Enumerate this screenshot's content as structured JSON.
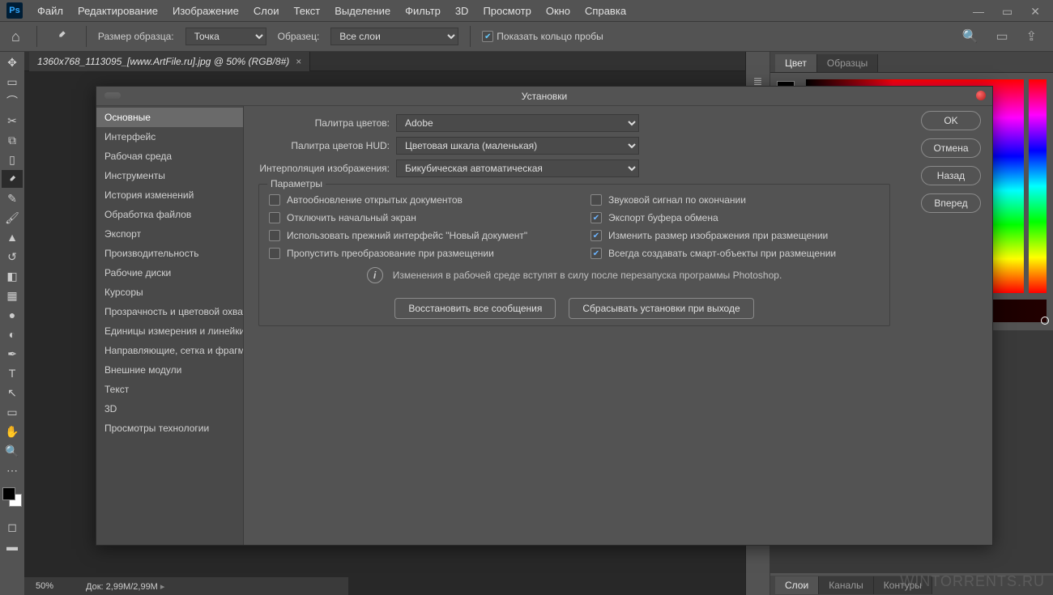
{
  "menubar": {
    "items": [
      "Файл",
      "Редактирование",
      "Изображение",
      "Слои",
      "Текст",
      "Выделение",
      "Фильтр",
      "3D",
      "Просмотр",
      "Окно",
      "Справка"
    ]
  },
  "optionsbar": {
    "sample_label": "Размер образца:",
    "sample_value": "Точка",
    "source_label": "Образец:",
    "source_value": "Все слои",
    "ring_label": "Показать кольцо пробы"
  },
  "document_tab": "1360x768_1113095_[www.ArtFile.ru].jpg @ 50% (RGB/8#)",
  "right_panel": {
    "tabs": [
      "Цвет",
      "Образцы"
    ],
    "lower_tabs": [
      "Слои",
      "Каналы",
      "Контуры"
    ]
  },
  "status": {
    "zoom": "50%",
    "doc": "Док: 2,99M/2,99M"
  },
  "dialog": {
    "title": "Установки",
    "categories": [
      "Основные",
      "Интерфейс",
      "Рабочая среда",
      "Инструменты",
      "История изменений",
      "Обработка файлов",
      "Экспорт",
      "Производительность",
      "Рабочие диски",
      "Курсоры",
      "Прозрачность и цветовой охват",
      "Единицы измерения и линейки",
      "Направляющие, сетка и фрагменты",
      "Внешние модули",
      "Текст",
      "3D",
      "Просмотры технологии"
    ],
    "active_category": 0,
    "rows": {
      "picker_label": "Палитра цветов:",
      "picker_value": "Adobe",
      "hud_label": "Палитра цветов HUD:",
      "hud_value": "Цветовая шкала (маленькая)",
      "interp_label": "Интерполяция изображения:",
      "interp_value": "Бикубическая автоматическая"
    },
    "fieldset_legend": "Параметры",
    "checks_left": [
      {
        "label": "Автообновление открытых документов",
        "on": false
      },
      {
        "label": "Отключить начальный экран",
        "on": false
      },
      {
        "label": "Использовать прежний интерфейс \"Новый документ\"",
        "on": false
      },
      {
        "label": "Пропустить преобразование при размещении",
        "on": false
      }
    ],
    "checks_right": [
      {
        "label": "Звуковой сигнал по окончании",
        "on": false
      },
      {
        "label": "Экспорт буфера обмена",
        "on": true
      },
      {
        "label": "Изменить размер изображения при размещении",
        "on": true
      },
      {
        "label": "Всегда создавать смарт-объекты при размещении",
        "on": true
      }
    ],
    "info_text": "Изменения в рабочей среде вступят в силу после перезапуска программы Photoshop.",
    "reset_msgs": "Восстановить все сообщения",
    "reset_on_quit": "Сбрасывать установки при выходе",
    "buttons": {
      "ok": "OK",
      "cancel": "Отмена",
      "prev": "Назад",
      "next": "Вперед"
    }
  },
  "watermark": "WINTORRENTS.RU"
}
